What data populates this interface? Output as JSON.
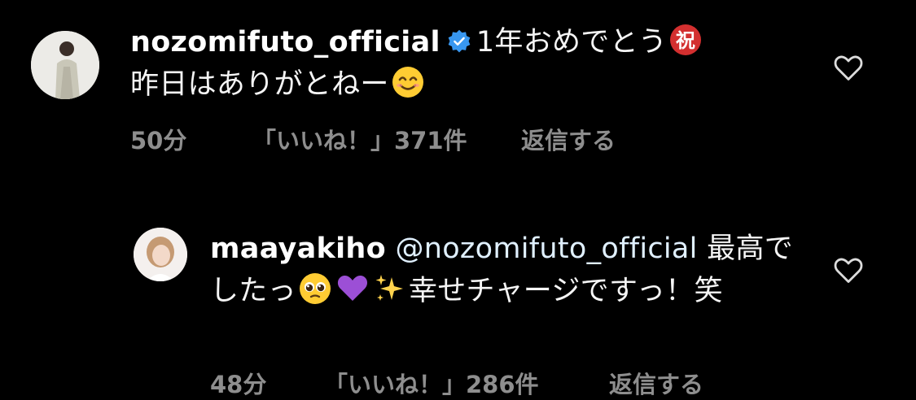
{
  "comments": [
    {
      "username": "nozomifuto_official",
      "verified": true,
      "text_part1": "1年おめでとう",
      "emoji_1": "congratulations-emoji",
      "text_part2": "昨日はありがとねー",
      "emoji_2": "smiling-face-emoji",
      "time": "50分",
      "likes": "「いいね！」371件",
      "reply": "返信する",
      "like_icon": "heart-outline-icon"
    },
    {
      "username": "maayakiho",
      "mention": "@nozomifuto_official",
      "text_part1": "最高でしたっ",
      "emoji_1": "pleading-face-emoji",
      "emoji_2": "purple-heart-emoji",
      "emoji_3": "sparkles-emoji",
      "text_part2": "幸せチャージですっ！笑",
      "time": "48分",
      "likes": "「いいね！」286件",
      "reply": "返信する",
      "like_icon": "heart-outline-icon"
    }
  ],
  "colors": {
    "background": "#000000",
    "text": "#f5f5f5",
    "meta": "#8e8e8e",
    "verified": "#3897f0"
  }
}
